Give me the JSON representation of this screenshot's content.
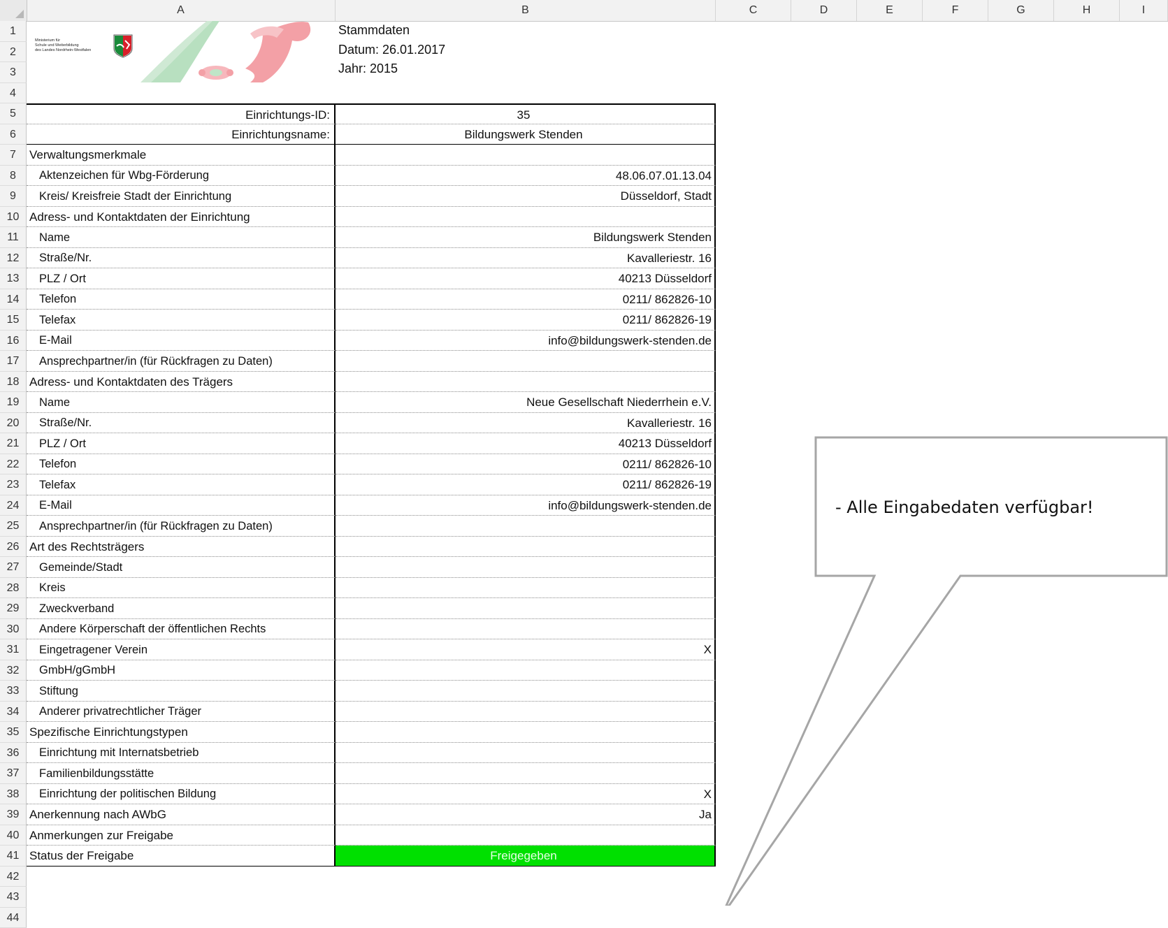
{
  "columns": [
    "A",
    "B",
    "C",
    "D",
    "E",
    "F",
    "G",
    "H",
    "I"
  ],
  "header": {
    "logo_text": [
      "Ministerium für",
      "Schule und Weiterbildung",
      "des Landes Nordrhein-Westfalen"
    ],
    "title": "Stammdaten",
    "date": "Datum: 26.01.2017",
    "year": "Jahr: 2015"
  },
  "rows": [
    {
      "n": "1"
    },
    {
      "n": "2"
    },
    {
      "n": "3"
    },
    {
      "n": "4"
    },
    {
      "n": "5",
      "label": "Einrichtungs-ID:",
      "value": "35"
    },
    {
      "n": "6",
      "label": "Einrichtungsname:",
      "value": "Bildungswerk Stenden"
    },
    {
      "n": "7",
      "label": "Verwaltungsmerkmale",
      "value": ""
    },
    {
      "n": "8",
      "label": "Aktenzeichen für Wbg-Förderung",
      "value": "48.06.07.01.13.04"
    },
    {
      "n": "9",
      "label": "Kreis/ Kreisfreie Stadt der Einrichtung",
      "value": "Düsseldorf, Stadt"
    },
    {
      "n": "10",
      "label": "Adress- und Kontaktdaten der Einrichtung",
      "value": ""
    },
    {
      "n": "11",
      "label": "Name",
      "value": "Bildungswerk Stenden"
    },
    {
      "n": "12",
      "label": "Straße/Nr.",
      "value": "Kavalleriestr. 16"
    },
    {
      "n": "13",
      "label": "PLZ / Ort",
      "value": "40213 Düsseldorf"
    },
    {
      "n": "14",
      "label": "Telefon",
      "value": "0211/ 862826-10"
    },
    {
      "n": "15",
      "label": "Telefax",
      "value": "0211/ 862826-19"
    },
    {
      "n": "16",
      "label": "E-Mail",
      "value": "info@bildungswerk-stenden.de"
    },
    {
      "n": "17",
      "label": "Ansprechpartner/in (für Rückfragen zu Daten)",
      "value": ""
    },
    {
      "n": "18",
      "label": "Adress- und Kontaktdaten des Trägers",
      "value": ""
    },
    {
      "n": "19",
      "label": "Name",
      "value": "Neue Gesellschaft Niederrhein e.V."
    },
    {
      "n": "20",
      "label": "Straße/Nr.",
      "value": "Kavalleriestr. 16"
    },
    {
      "n": "21",
      "label": "PLZ / Ort",
      "value": "40213 Düsseldorf"
    },
    {
      "n": "22",
      "label": "Telefon",
      "value": "0211/ 862826-10"
    },
    {
      "n": "23",
      "label": "Telefax",
      "value": "0211/ 862826-19"
    },
    {
      "n": "24",
      "label": "E-Mail",
      "value": "info@bildungswerk-stenden.de"
    },
    {
      "n": "25",
      "label": "Ansprechpartner/in (für Rückfragen zu Daten)",
      "value": ""
    },
    {
      "n": "26",
      "label": "Art des Rechtsträgers",
      "value": ""
    },
    {
      "n": "27",
      "label": "Gemeinde/Stadt",
      "value": ""
    },
    {
      "n": "28",
      "label": "Kreis",
      "value": ""
    },
    {
      "n": "29",
      "label": "Zweckverband",
      "value": ""
    },
    {
      "n": "30",
      "label": "Andere Körperschaft der öffentlichen Rechts",
      "value": ""
    },
    {
      "n": "31",
      "label": "Eingetragener Verein",
      "value": "X"
    },
    {
      "n": "32",
      "label": "GmbH/gGmbH",
      "value": ""
    },
    {
      "n": "33",
      "label": "Stiftung",
      "value": ""
    },
    {
      "n": "34",
      "label": "Anderer privatrechtlicher Träger",
      "value": ""
    },
    {
      "n": "35",
      "label": "Spezifische Einrichtungstypen",
      "value": ""
    },
    {
      "n": "36",
      "label": "Einrichtung mit Internatsbetrieb",
      "value": ""
    },
    {
      "n": "37",
      "label": "Familienbildungsstätte",
      "value": ""
    },
    {
      "n": "38",
      "label": "Einrichtung der politischen Bildung",
      "value": "X"
    },
    {
      "n": "39",
      "label": "Anerkennung nach AWbG",
      "value": "Ja"
    },
    {
      "n": "40",
      "label": "Anmerkungen zur Freigabe",
      "value": ""
    },
    {
      "n": "41",
      "label": "Status der Freigabe",
      "value": "Freigegeben"
    },
    {
      "n": "42"
    },
    {
      "n": "43"
    },
    {
      "n": "44"
    }
  ],
  "callout": {
    "text": "- Alle Eingabedaten verfügbar!"
  },
  "colors": {
    "status_green": "#00e000",
    "grid_border": "#000000"
  }
}
